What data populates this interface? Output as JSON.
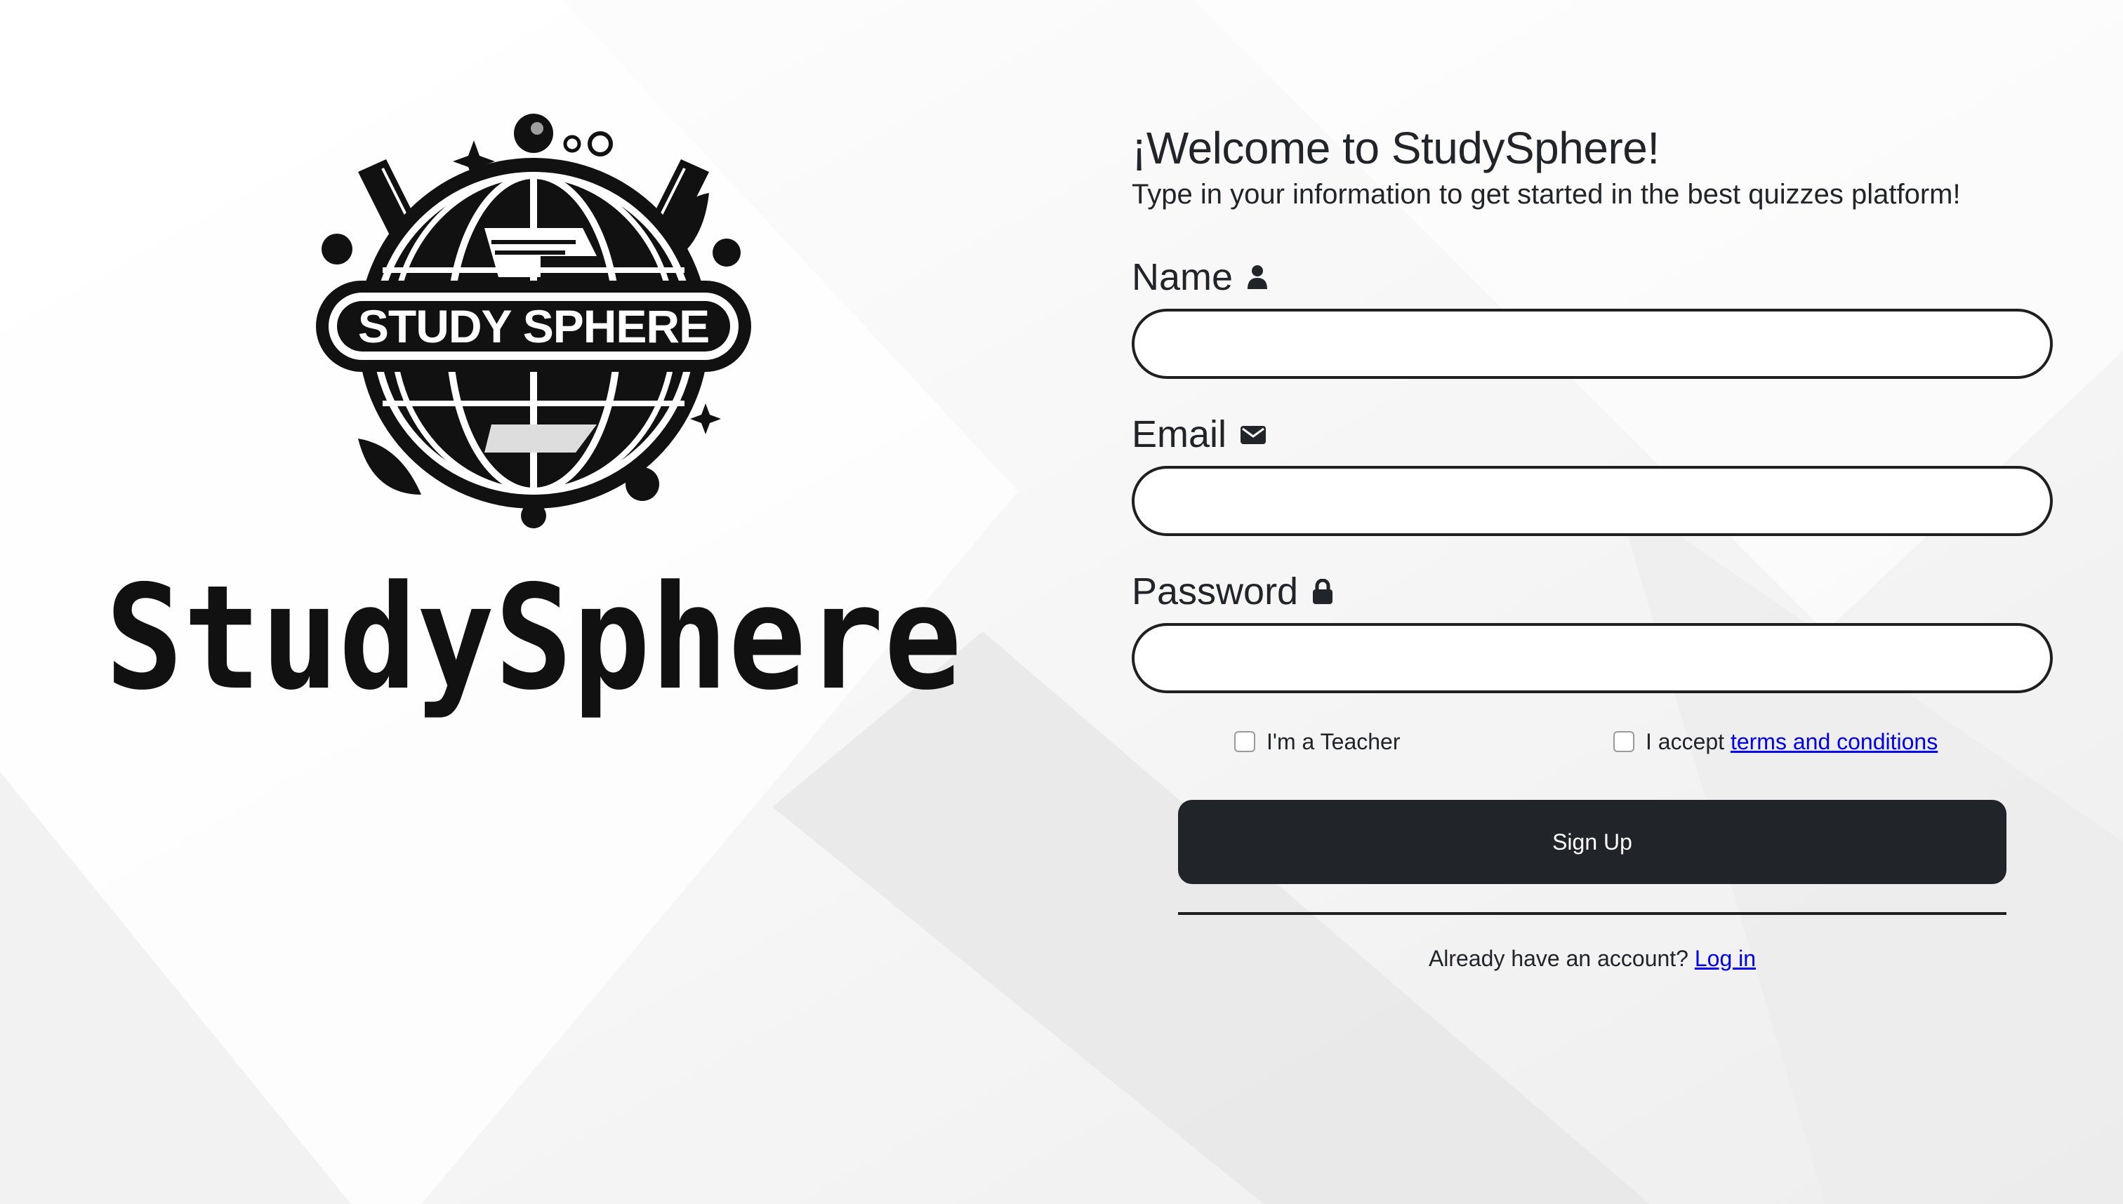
{
  "brand": {
    "emblem_text": "STUDY SPHERE",
    "wordmark": "StudySphere"
  },
  "form": {
    "title": "¡Welcome to StudySphere!",
    "subtitle": "Type in your information to get started in the best quizzes platform!",
    "fields": {
      "name": {
        "label": "Name",
        "icon": "user-icon",
        "value": ""
      },
      "email": {
        "label": "Email",
        "icon": "envelope-icon",
        "value": ""
      },
      "password": {
        "label": "Password",
        "icon": "lock-icon",
        "value": ""
      }
    },
    "teacher_checkbox": {
      "label": "I'm a Teacher",
      "checked": false
    },
    "terms_checkbox": {
      "label_prefix": "I accept",
      "link_text": "terms and conditions",
      "checked": false
    },
    "signup_label": "Sign Up",
    "login_prompt": "Already have an account?",
    "login_link": "Log in"
  },
  "colors": {
    "button_bg": "#212529",
    "button_text": "#ffffff",
    "text": "#212529",
    "link": "#0000ee",
    "input_border": "#1f1f1f"
  }
}
